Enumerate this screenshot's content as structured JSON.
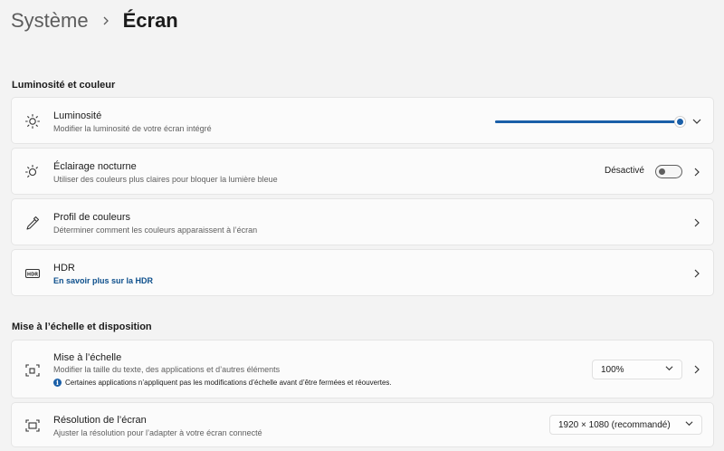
{
  "breadcrumb": {
    "parent": "Système",
    "current": "Écran"
  },
  "sections": {
    "brightness_color": "Luminosité et couleur",
    "scale_layout": "Mise à l’échelle et disposition"
  },
  "brightness": {
    "title": "Luminosité",
    "description": "Modifier la luminosité de votre écran intégré",
    "value_fraction": 1.0,
    "icon": "sun-icon"
  },
  "night_light": {
    "title": "Éclairage nocturne",
    "description": "Utiliser des couleurs plus claires pour bloquer la lumière bleue",
    "status": "Désactivé",
    "icon": "night-light-icon"
  },
  "color_profile": {
    "title": "Profil de couleurs",
    "description": "Déterminer comment les couleurs apparaissent à l’écran",
    "icon": "eyedropper-icon"
  },
  "hdr": {
    "title": "HDR",
    "link": "En savoir plus sur la HDR",
    "icon": "hdr-icon"
  },
  "scale": {
    "title": "Mise à l’échelle",
    "description": "Modifier la taille du texte, des applications et d’autres éléments",
    "note": "Certaines applications n’appliquent pas les modifications d’échelle avant d’être fermées et réouvertes.",
    "value": "100%",
    "icon": "scale-icon"
  },
  "resolution": {
    "title": "Résolution de l’écran",
    "description": "Ajuster la résolution pour l’adapter à  votre  écran connecté",
    "value": "1920 × 1080 (recommandé)",
    "icon": "resolution-icon"
  },
  "colors": {
    "accent": "#1a5fa8",
    "link": "#0d4f8c"
  }
}
